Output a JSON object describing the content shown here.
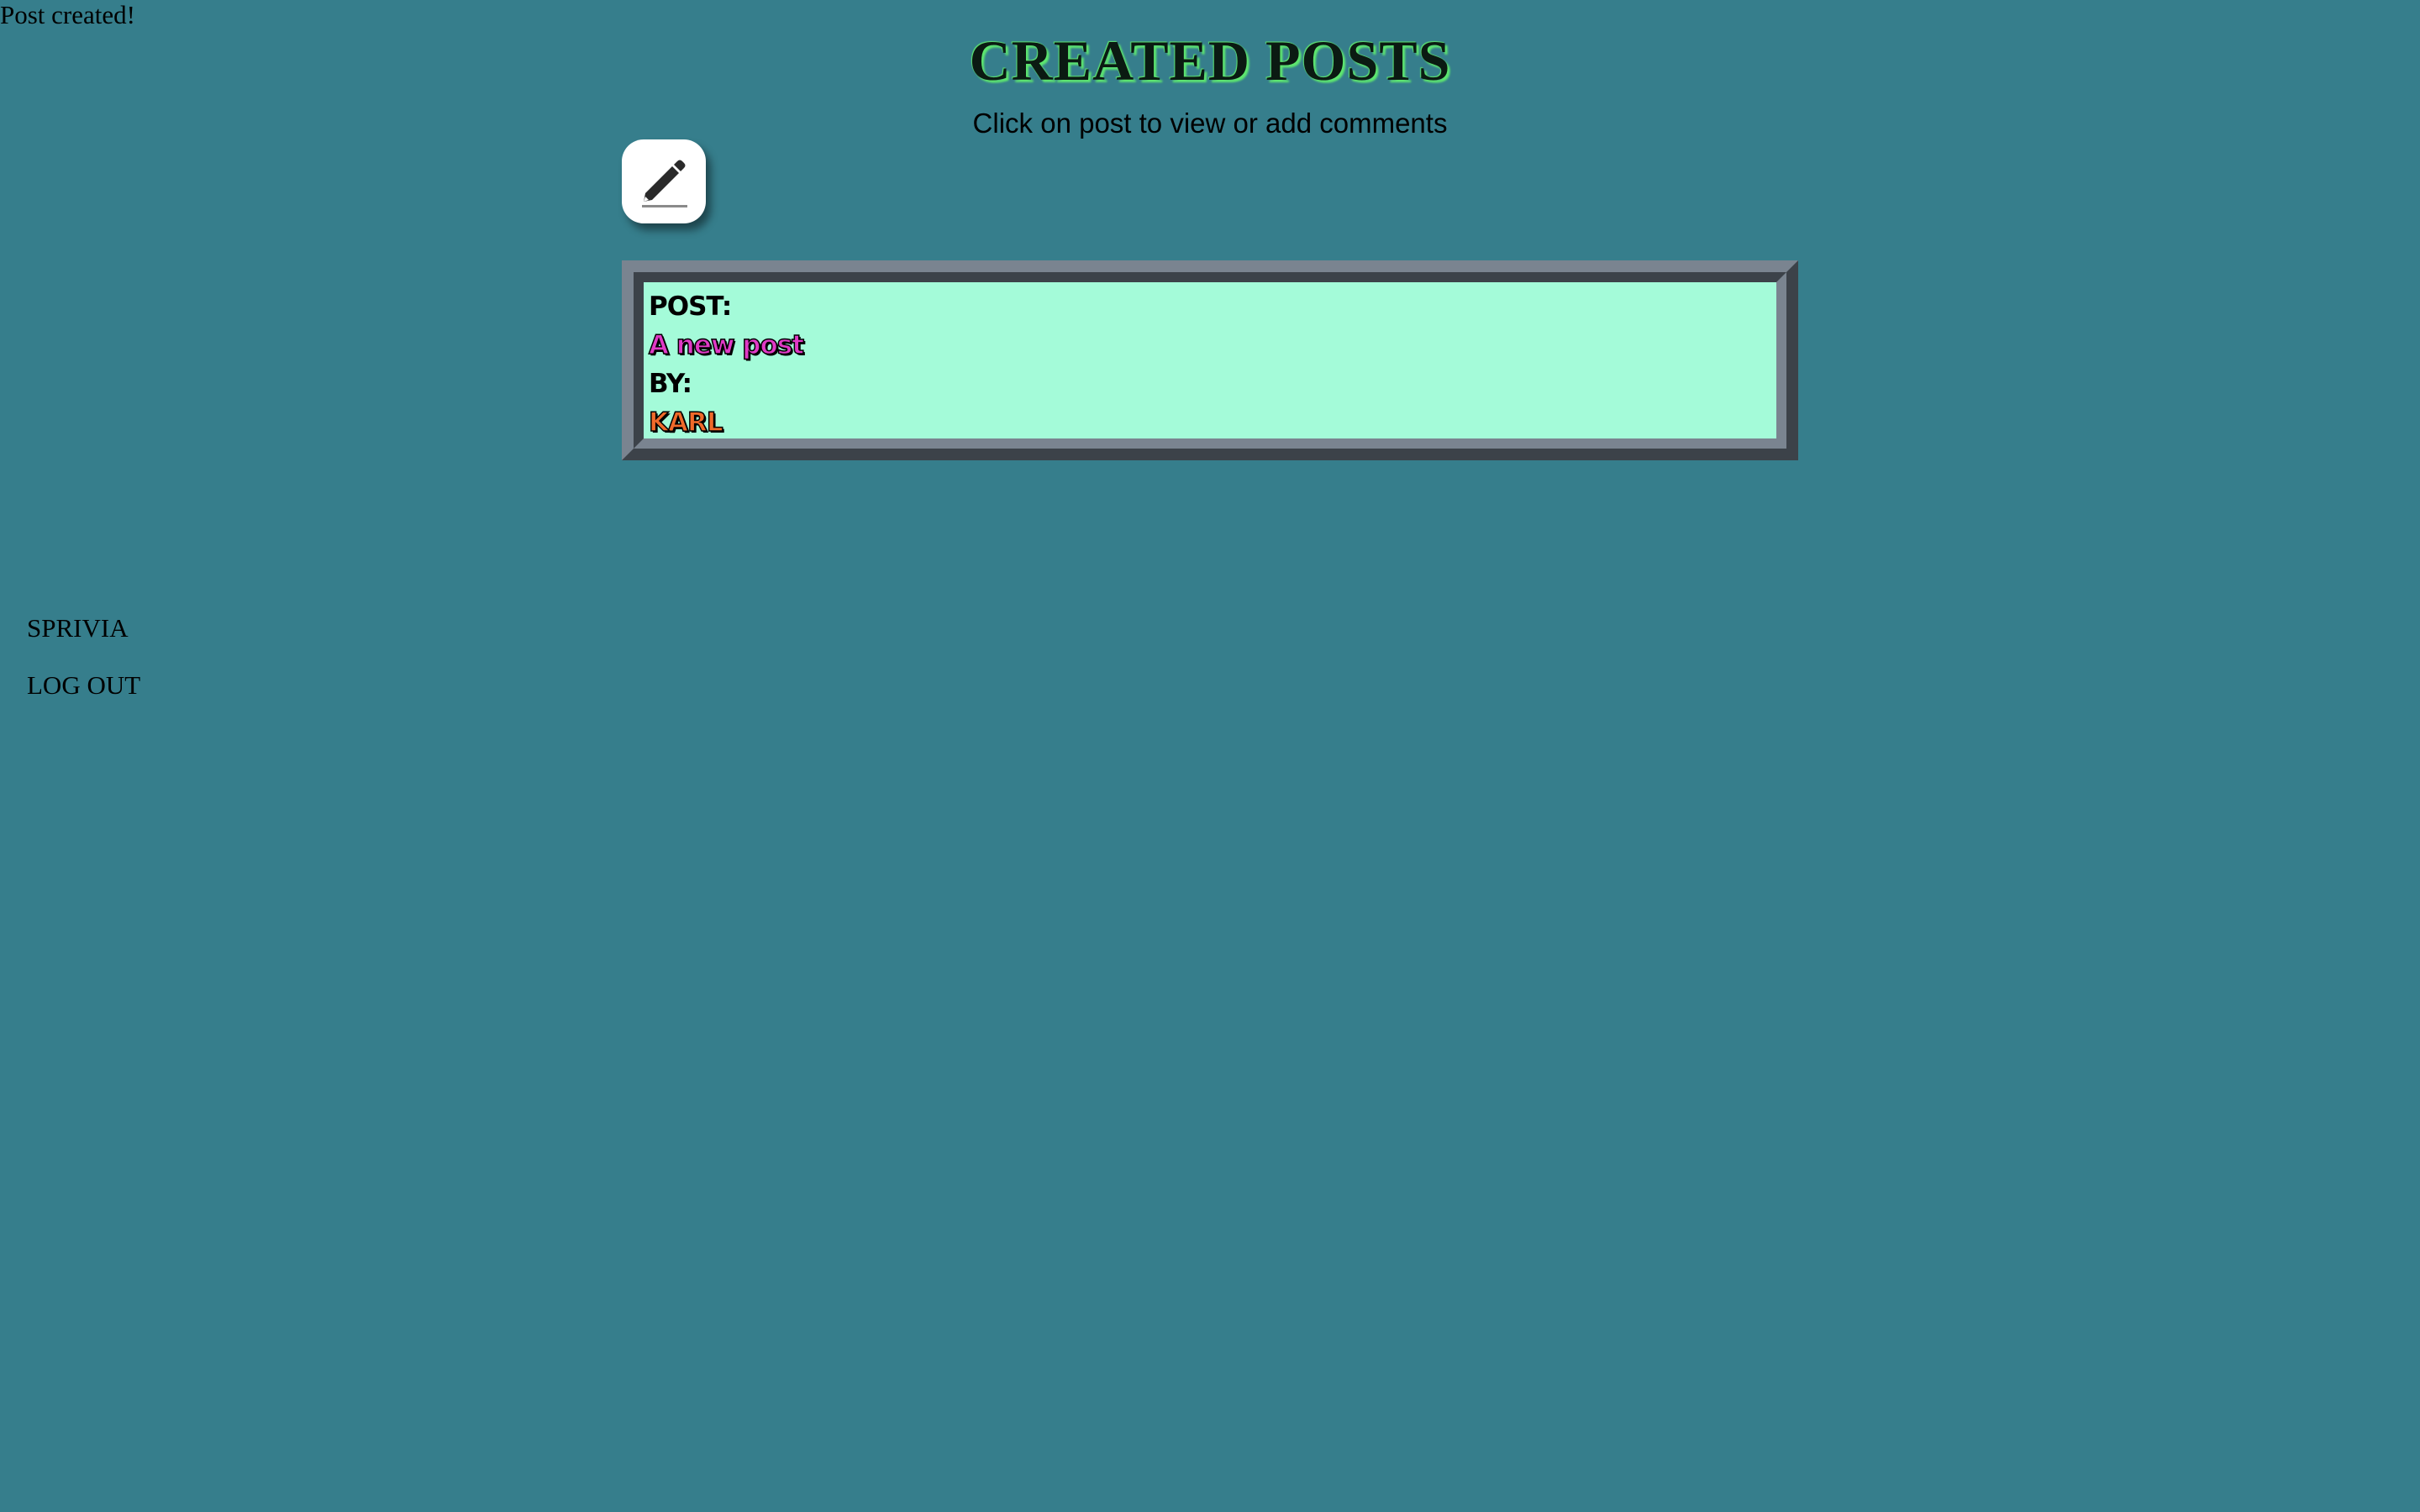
{
  "flash": {
    "message": "Post created!"
  },
  "header": {
    "title": "CREATED POSTS",
    "subtitle": "Click on post to view or add comments"
  },
  "compose": {
    "icon": "pencil-icon"
  },
  "posts": [
    {
      "post_label": "POST:",
      "title": "A new post",
      "by_label": "BY:",
      "author": "KARL"
    }
  ],
  "nav": {
    "items": [
      {
        "label": "SPRIVIA"
      },
      {
        "label": "LOG OUT"
      }
    ]
  },
  "colors": {
    "background": "#367e8c",
    "card_background": "#a4fbd9",
    "title_glow": "#5ee86f",
    "post_title": "#e03ac6",
    "post_author": "#f06a2a"
  }
}
